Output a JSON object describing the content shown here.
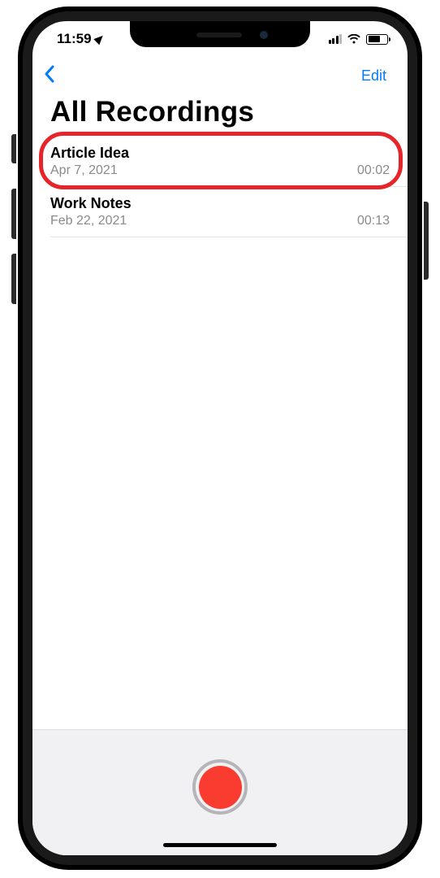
{
  "status_bar": {
    "time": "11:59"
  },
  "nav": {
    "edit_label": "Edit"
  },
  "page": {
    "title": "All Recordings"
  },
  "recordings": [
    {
      "title": "Article Idea",
      "date": "Apr 7, 2021",
      "duration": "00:02",
      "highlighted": true
    },
    {
      "title": "Work Notes",
      "date": "Feb 22, 2021",
      "duration": "00:13",
      "highlighted": false
    }
  ]
}
